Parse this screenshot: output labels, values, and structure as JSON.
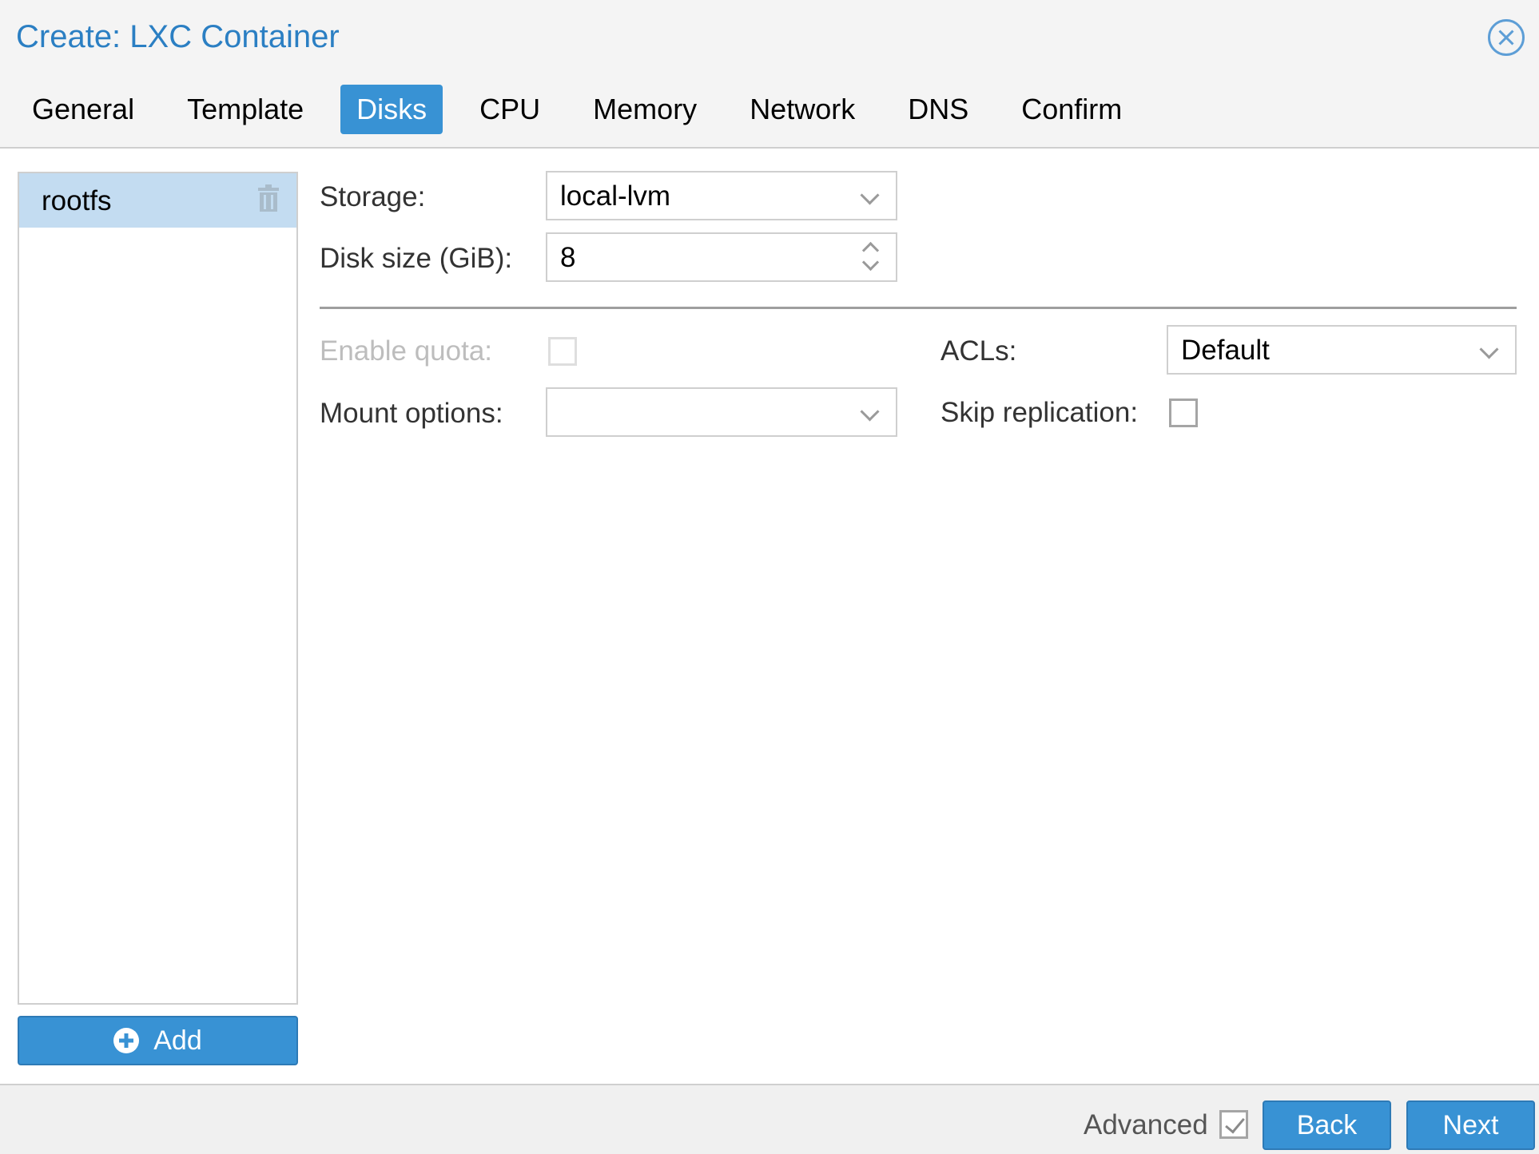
{
  "window": {
    "title": "Create: LXC Container"
  },
  "tabs": [
    {
      "label": "General",
      "active": false
    },
    {
      "label": "Template",
      "active": false
    },
    {
      "label": "Disks",
      "active": true
    },
    {
      "label": "CPU",
      "active": false
    },
    {
      "label": "Memory",
      "active": false
    },
    {
      "label": "Network",
      "active": false
    },
    {
      "label": "DNS",
      "active": false
    },
    {
      "label": "Confirm",
      "active": false
    }
  ],
  "disks": {
    "items": [
      {
        "label": "rootfs",
        "selected": true,
        "icon": "trash-icon"
      }
    ],
    "add_label": "Add"
  },
  "form": {
    "storage": {
      "label": "Storage:",
      "value": "local-lvm"
    },
    "disk_size": {
      "label": "Disk size (GiB):",
      "value": "8"
    },
    "enable_quota": {
      "label": "Enable quota:",
      "checked": false,
      "disabled": true
    },
    "mount_options": {
      "label": "Mount options:",
      "value": ""
    },
    "acls": {
      "label": "ACLs:",
      "value": "Default"
    },
    "skip_replication": {
      "label": "Skip replication:",
      "checked": false
    }
  },
  "footer": {
    "advanced_label": "Advanced",
    "advanced_checked": true,
    "back_label": "Back",
    "next_label": "Next"
  },
  "colors": {
    "accent": "#3892d4",
    "title": "#2b7fc3",
    "selected_row": "#c3dcf1"
  }
}
